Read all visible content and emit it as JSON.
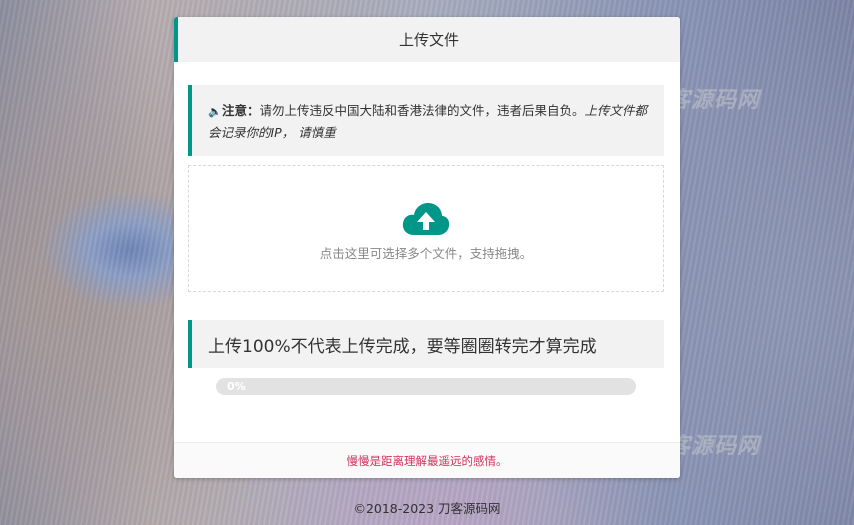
{
  "page": {
    "title": "上传文件",
    "notice": {
      "label": "注意：",
      "text": "请勿上传违反中国大陆和香港法律的文件，违者后果自负。",
      "italic": "上传文件都会记录你的IP， 请慎重"
    },
    "dropzone": {
      "icon": "cloud-upload-icon",
      "hint": "点击这里可选择多个文件，支持拖拽。"
    },
    "tip": "上传100%不代表上传完成，要等圈圈转完才算完成",
    "progress": {
      "value": 0,
      "label": "0%"
    },
    "footer_text": "慢慢是距离理解最遥远的感情。"
  },
  "watermark": "刀客源码网",
  "copyright": "©2018-2023 刀客源码网",
  "colors": {
    "accent": "#009688",
    "footer_text": "#d0325c",
    "panel_bg": "#ffffff",
    "header_bg": "#f2f2f2"
  }
}
